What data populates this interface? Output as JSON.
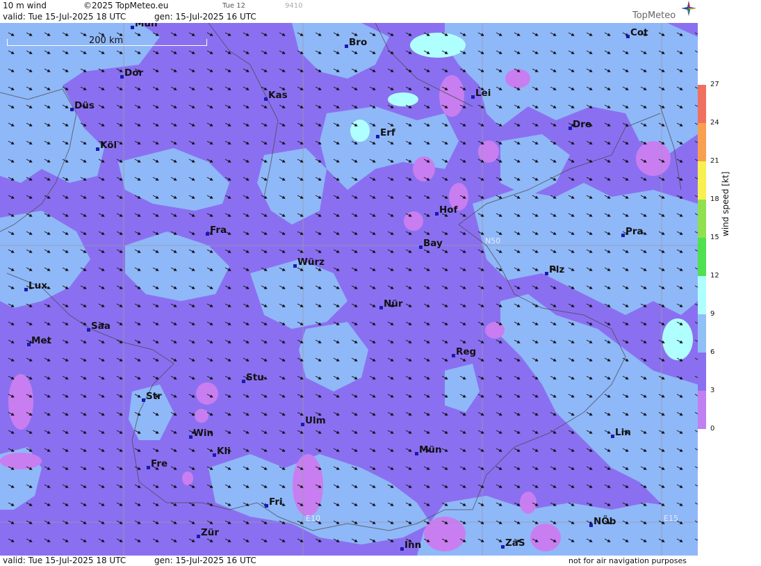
{
  "header": {
    "product": "10 m wind",
    "copyright": "©2025 TopMeteo.eu",
    "run_short": "Tue 12",
    "code": "9410",
    "valid": "valid:  Tue  15-Jul-2025  18 UTC",
    "gen": "gen: 15-Jul-2025 16 UTC",
    "logo": "TopMeteo"
  },
  "footer": {
    "valid": "valid:  Tue  15-Jul-2025  18 UTC",
    "gen": "gen: 15-Jul-2025 16 UTC",
    "note": "not for air navigation purposes"
  },
  "scale": {
    "label": "200 km"
  },
  "grid_labels": [
    "N50",
    "E10",
    "E15"
  ],
  "cities": [
    {
      "name": "Mün"
    },
    {
      "name": "Bro"
    },
    {
      "name": "Cot"
    },
    {
      "name": "Dor"
    },
    {
      "name": "Kas"
    },
    {
      "name": "Lei"
    },
    {
      "name": "Düs"
    },
    {
      "name": "Erf"
    },
    {
      "name": "Dre"
    },
    {
      "name": "Köl"
    },
    {
      "name": "Hof"
    },
    {
      "name": "Fra"
    },
    {
      "name": "Pra"
    },
    {
      "name": "Bay"
    },
    {
      "name": "Würz"
    },
    {
      "name": "Plz"
    },
    {
      "name": "Lux"
    },
    {
      "name": "Nür"
    },
    {
      "name": "Saa"
    },
    {
      "name": "Met"
    },
    {
      "name": "Reg"
    },
    {
      "name": "Stu"
    },
    {
      "name": "Str"
    },
    {
      "name": "Ulm"
    },
    {
      "name": "Win"
    },
    {
      "name": "Lin"
    },
    {
      "name": "Kli"
    },
    {
      "name": "Mün"
    },
    {
      "name": "Fre"
    },
    {
      "name": "Fri"
    },
    {
      "name": "NÖb"
    },
    {
      "name": "Zür"
    },
    {
      "name": "Inn"
    },
    {
      "name": "ZaS"
    }
  ],
  "legend": {
    "title": "wind speed [kt]",
    "ticks": [
      "27",
      "24",
      "21",
      "18",
      "15",
      "12",
      "9",
      "6",
      "3",
      "0"
    ],
    "colors": [
      "#f07060",
      "#f8a050",
      "#f8f050",
      "#90e050",
      "#50e050",
      "#b0ffff",
      "#90c0f8",
      "#8a70f0",
      "#c080f0"
    ]
  },
  "colors": {
    "calm": "#c87ef0",
    "light": "#8a70f0",
    "moderate": "#8fb8f8",
    "fresh": "#b0ffff"
  }
}
